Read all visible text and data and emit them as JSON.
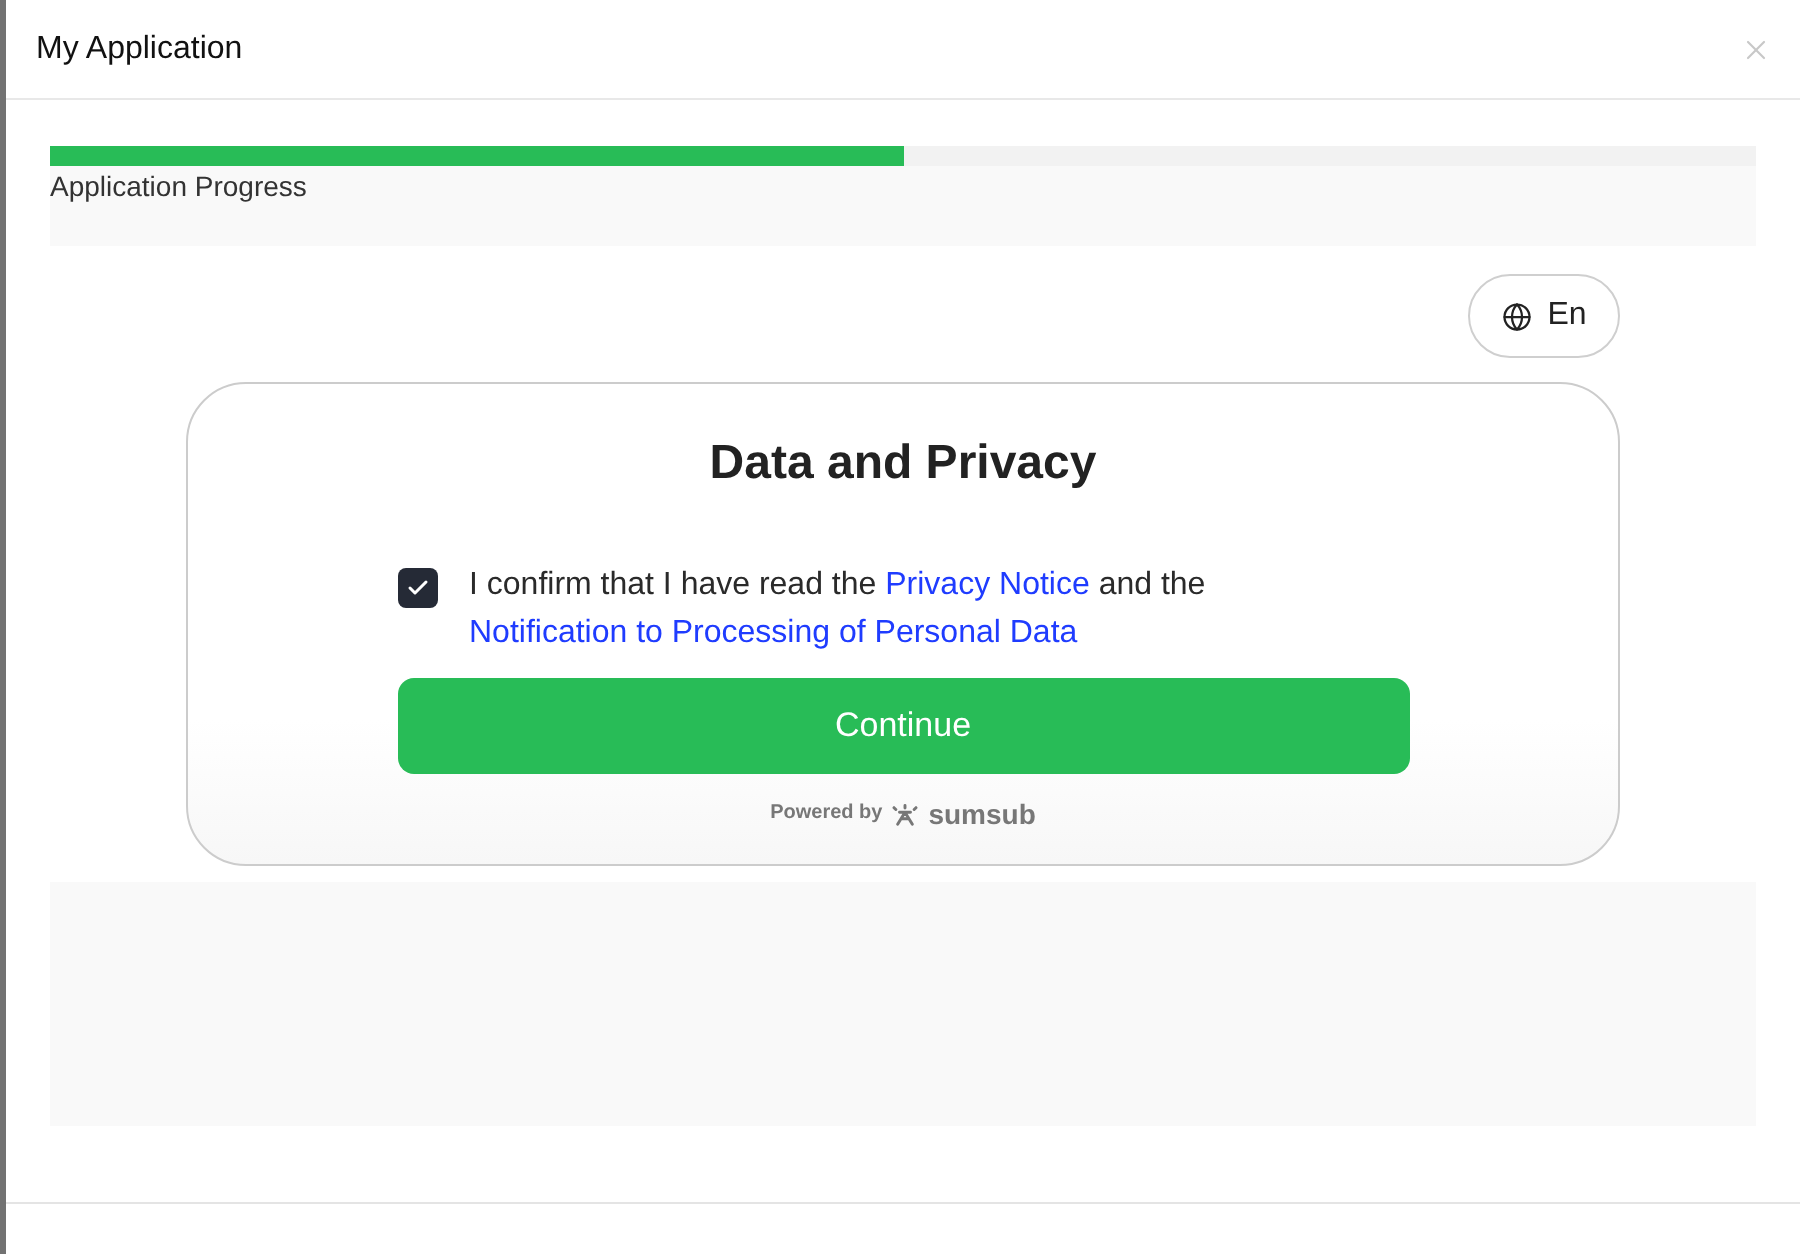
{
  "modal": {
    "title": "My Application"
  },
  "progress": {
    "label": "Application Progress",
    "level": 0.5
  },
  "language": {
    "label": "En"
  },
  "card": {
    "title": "Data and Privacy",
    "consent": {
      "checked": true,
      "parts": [
        {
          "kind": "text",
          "text": "I confirm that I have read the"
        },
        {
          "kind": "link",
          "text": "Privacy Notice"
        },
        {
          "kind": "text",
          "text": "and the"
        },
        {
          "kind": "link",
          "text": "Notification to Processing of Personal Data"
        }
      ]
    },
    "button": "Continue",
    "powered": {
      "text": "Powered by",
      "brand": "sumsub"
    }
  }
}
